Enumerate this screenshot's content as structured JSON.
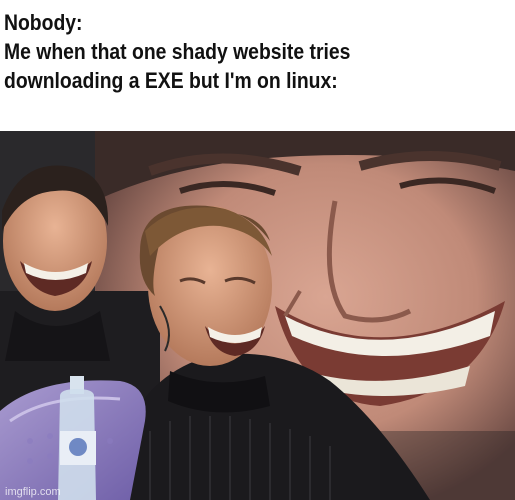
{
  "caption": {
    "line1": "Nobody:",
    "line2": "Me when that one shady website tries",
    "line3": "downloading a EXE but I'm on linux:"
  },
  "watermark": "imgflip.com"
}
